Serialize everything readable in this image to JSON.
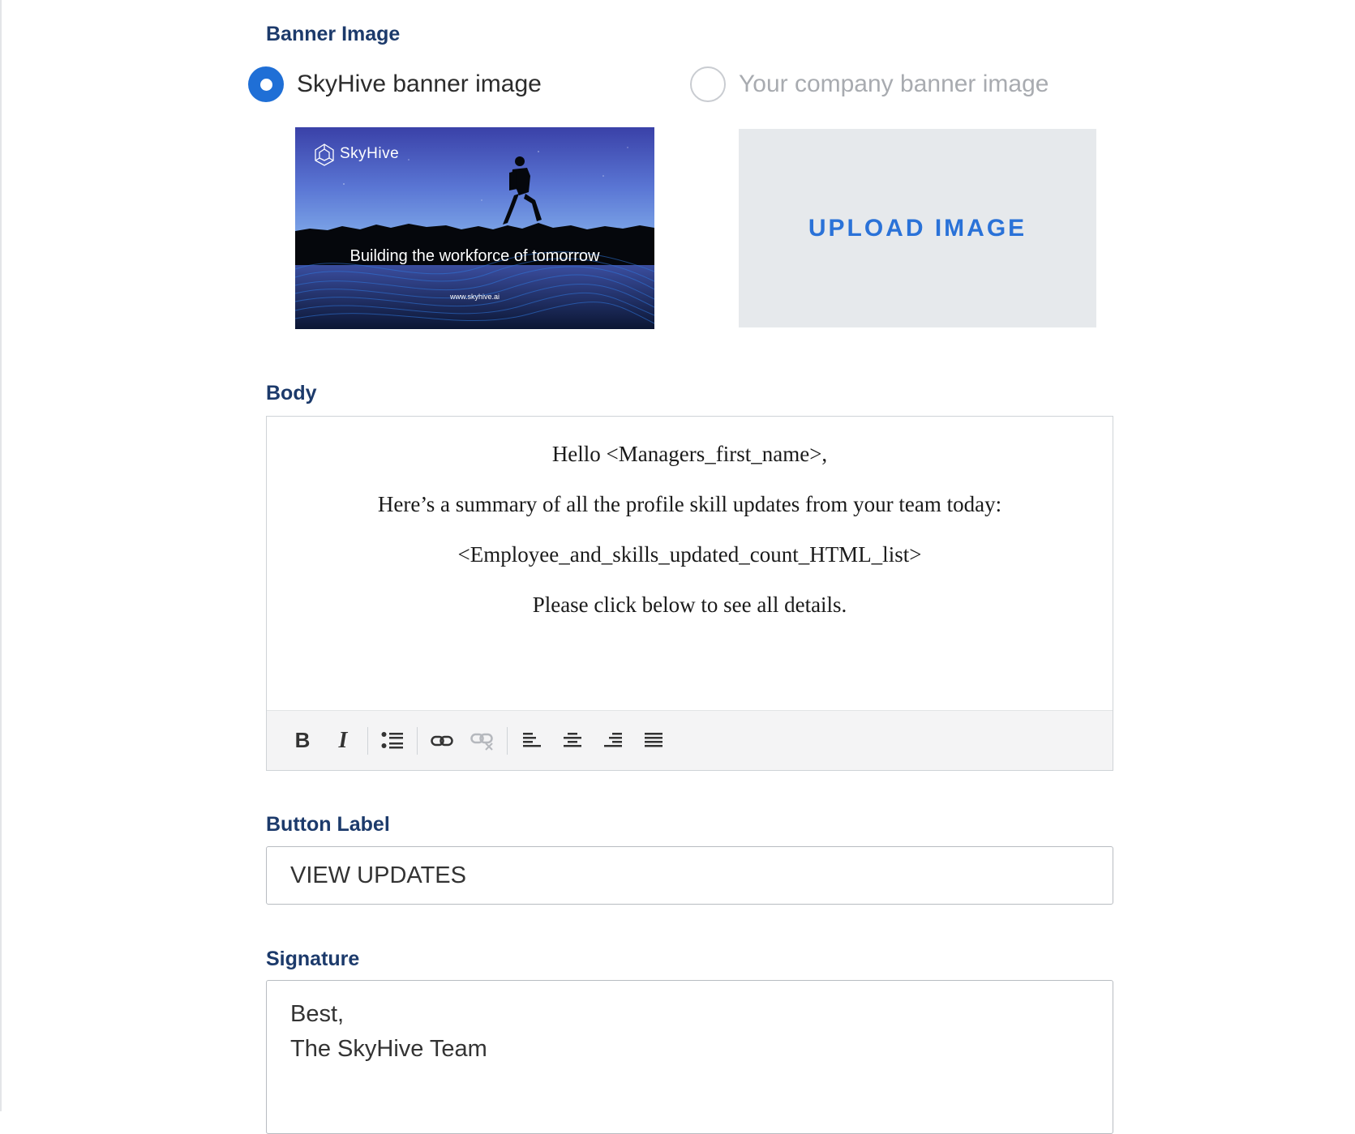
{
  "banner_section": {
    "label": "Banner Image",
    "options": [
      {
        "label": "SkyHive banner image",
        "selected": true
      },
      {
        "label": "Your company banner image",
        "selected": false
      }
    ],
    "preview": {
      "logo_text": "SkyHive",
      "tagline": "Building the workforce of tomorrow",
      "url": "www.skyhive.ai"
    },
    "upload_label": "UPLOAD IMAGE"
  },
  "body_section": {
    "label": "Body",
    "paragraphs": [
      "Hello <Managers_first_name>,",
      "Here’s a summary of all the profile skill updates from your team today:",
      "<Employee_and_skills_updated_count_HTML_list>",
      "Please click below to see all details."
    ],
    "toolbar": [
      "bold-icon",
      "italic-icon",
      "bulleted-list-icon",
      "link-icon",
      "unlink-icon",
      "align-left-icon",
      "align-center-icon",
      "align-right-icon",
      "justify-icon"
    ]
  },
  "button_label_section": {
    "label": "Button Label",
    "value": "VIEW UPDATES"
  },
  "signature_section": {
    "label": "Signature",
    "value": "Best,\nThe SkyHive Team"
  },
  "colors": {
    "accent": "#1f6fd6",
    "label": "#1c3a6b",
    "upload_bg": "#e6e9ec"
  }
}
